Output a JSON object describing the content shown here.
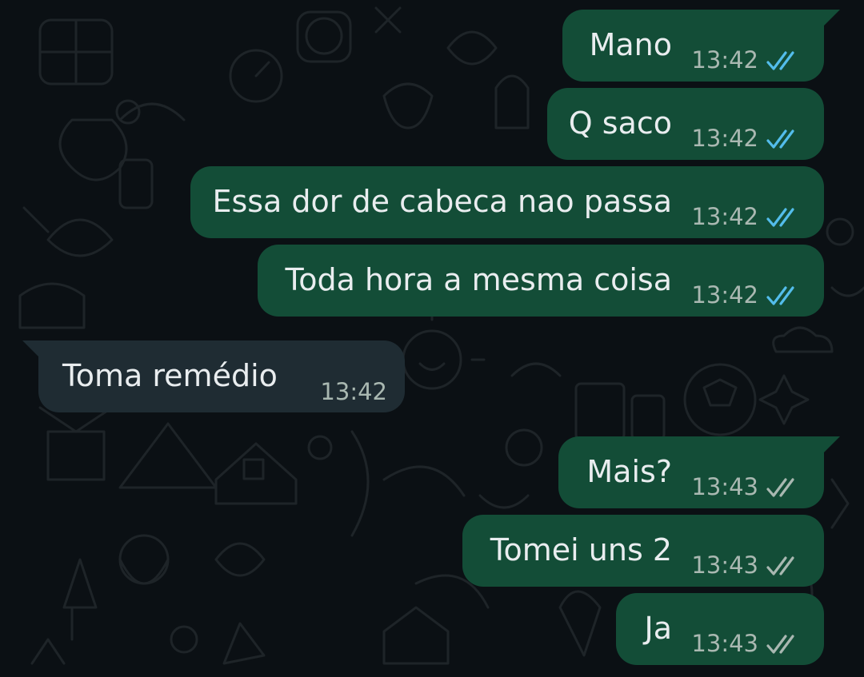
{
  "colors": {
    "background": "#0b1014",
    "outgoing_bubble": "#134d37",
    "incoming_bubble": "#1f2c33",
    "text": "#e9edef",
    "timestamp": "#a9b8b1",
    "read_tick": "#53bdeb",
    "delivered_tick": "#a9b8b1"
  },
  "messages": [
    {
      "direction": "outgoing",
      "text": "Mano",
      "time": "13:42",
      "status": "read",
      "status_icon": "double-check-read-icon"
    },
    {
      "direction": "outgoing",
      "text": "Q saco",
      "time": "13:42",
      "status": "read",
      "status_icon": "double-check-read-icon"
    },
    {
      "direction": "outgoing",
      "text": "Essa dor de cabeca nao passa",
      "time": "13:42",
      "status": "read",
      "status_icon": "double-check-read-icon"
    },
    {
      "direction": "outgoing",
      "text": "Toda hora a mesma coisa",
      "time": "13:42",
      "status": "read",
      "status_icon": "double-check-read-icon"
    },
    {
      "direction": "incoming",
      "text": "Toma remédio",
      "time": "13:42"
    },
    {
      "direction": "outgoing",
      "text": "Mais?",
      "time": "13:43",
      "status": "delivered",
      "status_icon": "double-check-delivered-icon"
    },
    {
      "direction": "outgoing",
      "text": "Tomei uns 2",
      "time": "13:43",
      "status": "delivered",
      "status_icon": "double-check-delivered-icon"
    },
    {
      "direction": "outgoing",
      "text": "Ja",
      "time": "13:43",
      "status": "delivered",
      "status_icon": "double-check-delivered-icon"
    }
  ]
}
